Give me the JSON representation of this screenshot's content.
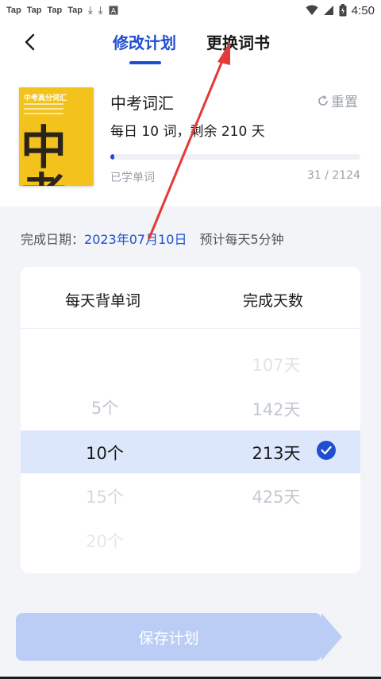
{
  "status_bar": {
    "apps": [
      "Tap",
      "Tap",
      "Tap",
      "Tap"
    ],
    "time": "4:50"
  },
  "header": {
    "tabs": [
      {
        "label": "修改计划",
        "active": true
      },
      {
        "label": "更换词书",
        "active": false
      }
    ]
  },
  "book": {
    "cover_title": "中考高分词汇",
    "cover_big": "中考",
    "name": "中考词汇",
    "reset_label": "重置",
    "plan_desc": "每日 10 词，剩余 210 天",
    "progress_fraction": 0.0146,
    "learned_label": "已学单词",
    "learned_count": "31 / 2124"
  },
  "completion": {
    "label": "完成日期：",
    "date": "2023年07月10日",
    "estimate": "预计每天5分钟"
  },
  "picker": {
    "col1_header": "每天背单词",
    "col2_header": "完成天数",
    "words_per_day": [
      "5个",
      "10个",
      "15个",
      "20个"
    ],
    "days": [
      "107天",
      "142天",
      "213天",
      "425天"
    ],
    "selected_words": "10个",
    "selected_days": "213天"
  },
  "save_button": "保存计划",
  "colors": {
    "accent": "#1f4fd1",
    "selection_band": "#dde7fb",
    "save_button": "#bccdf5",
    "annotation_arrow": "#e53935"
  }
}
